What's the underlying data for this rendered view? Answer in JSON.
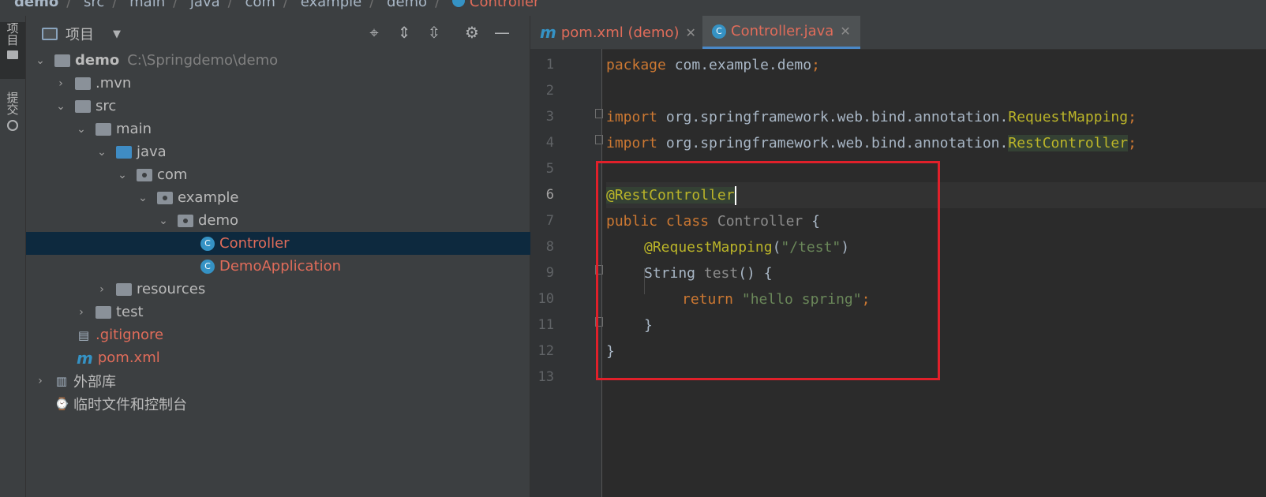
{
  "breadcrumb": [
    "demo",
    "src",
    "main",
    "java",
    "com",
    "example",
    "demo",
    "Controller"
  ],
  "side_stripe": {
    "project_label": "项目",
    "commit_label": "提交"
  },
  "project_panel": {
    "title": "项目",
    "tree": [
      {
        "label": "demo",
        "path": "C:\\Springdemo\\demo"
      },
      {
        "label": ".mvn"
      },
      {
        "label": "src"
      },
      {
        "label": "main"
      },
      {
        "label": "java"
      },
      {
        "label": "com"
      },
      {
        "label": "example"
      },
      {
        "label": "demo"
      },
      {
        "label": "Controller"
      },
      {
        "label": "DemoApplication"
      },
      {
        "label": "resources"
      },
      {
        "label": "test"
      },
      {
        "label": ".gitignore"
      },
      {
        "label": "pom.xml"
      },
      {
        "label": "外部库"
      },
      {
        "label": "临时文件和控制台"
      }
    ]
  },
  "tabs": [
    {
      "label": "pom.xml (demo)"
    },
    {
      "label": "Controller.java"
    }
  ],
  "editor": {
    "line_numbers": [
      "1",
      "2",
      "3",
      "4",
      "5",
      "6",
      "7",
      "8",
      "9",
      "10",
      "11",
      "12",
      "13"
    ],
    "code": {
      "l1_kw": "package",
      "l1_rest": " com.example.demo",
      "l1_semi": ";",
      "l3_kw": "import",
      "l3_pkg": " org.springframework.web.bind.annotation.",
      "l3_cls": "RequestMapping",
      "l3_semi": ";",
      "l4_kw": "import",
      "l4_pkg": " org.springframework.web.bind.annotation.",
      "l4_cls": "RestController",
      "l4_semi": ";",
      "l6_ann": "@RestController",
      "l7_kw": "public class",
      "l7_name": " Controller",
      "l7_brace": " {",
      "l8_ann": "@RequestMapping",
      "l8_open": "(",
      "l8_str": "\"/test\"",
      "l8_close": ")",
      "l9_type": "String",
      "l9_fn": " test",
      "l9_rest": "() {",
      "l10_kw": "return",
      "l10_str": " \"hello spring\"",
      "l10_semi": ";",
      "l11": "}",
      "l12": "}"
    }
  },
  "colors": {
    "highlight_box": "#e0202a",
    "accent": "#3592c4",
    "modified_file": "#e06c5a"
  }
}
